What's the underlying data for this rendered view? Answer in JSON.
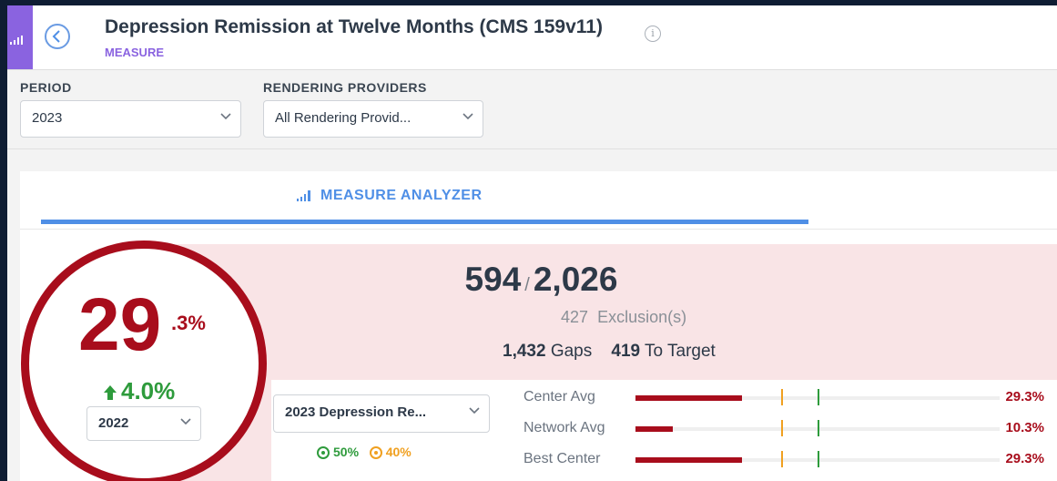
{
  "header": {
    "title": "Depression Remission at Twelve Months (CMS 159v11)",
    "subtitle": "MEASURE",
    "info_glyph": "i"
  },
  "filters": {
    "period": {
      "label": "PERIOD",
      "value": "2023"
    },
    "providers": {
      "label": "RENDERING PROVIDERS",
      "value": "All Rendering Provid..."
    }
  },
  "tab": {
    "label": "MEASURE ANALYZER"
  },
  "summary": {
    "rate_whole": "29",
    "rate_decimal": ".3%",
    "change": "4.0%",
    "compare_year": "2022",
    "numerator": "594",
    "separator": "/",
    "denominator": "2,026",
    "exclusions_count": "427",
    "exclusions_label": "Exclusion(s)",
    "gaps_count": "1,432",
    "gaps_label": "Gaps",
    "to_target_count": "419",
    "to_target_label": "To Target"
  },
  "benchmark_select": {
    "value": "2023 Depression Re..."
  },
  "targets": [
    {
      "value": "50%",
      "color": "#2e9b3c"
    },
    {
      "value": "40%",
      "color": "#f0a020"
    }
  ],
  "comparisons": [
    {
      "label": "Center Avg",
      "value": "29.3%",
      "fraction": 0.293
    },
    {
      "label": "Network Avg",
      "value": "10.3%",
      "fraction": 0.103
    },
    {
      "label": "Best Center",
      "value": "29.3%",
      "fraction": 0.293
    }
  ],
  "colors": {
    "accent_red": "#a80d1c",
    "accent_blue": "#4f8fe6",
    "accent_purple": "#8a63e0",
    "positive_green": "#2e9b3c",
    "target_orange": "#f0a020",
    "pink_panel": "#f9e4e6"
  },
  "icons": {
    "sidebar": "bar-chart-icon",
    "back": "chevron-left-icon",
    "info": "info-icon",
    "dropdown": "chevron-down-icon",
    "change": "arrow-up-icon",
    "tab": "bar-chart-icon",
    "target": "target-icon"
  }
}
